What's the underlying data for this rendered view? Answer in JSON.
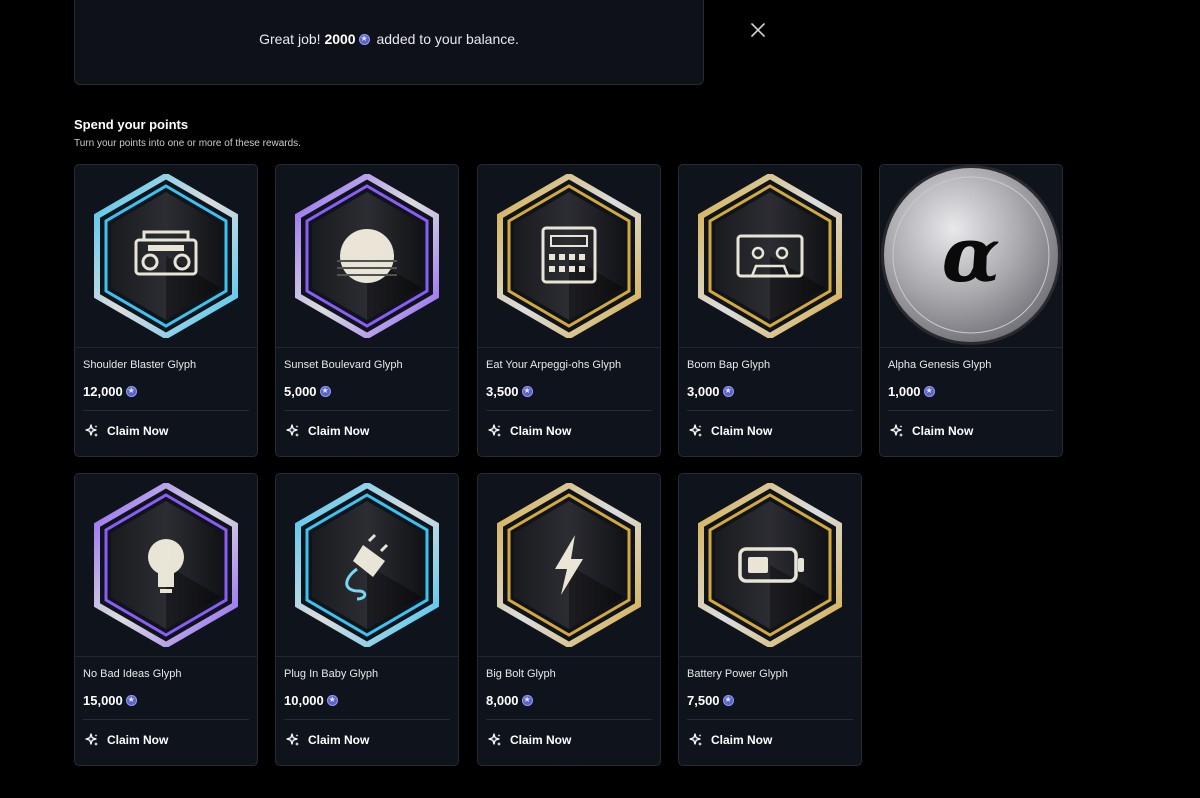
{
  "toast": {
    "prefix": "Great job!",
    "amount": "2000",
    "suffix": "added to your balance.",
    "close_icon": "close-icon"
  },
  "section": {
    "title": "Spend your points",
    "subtitle": "Turn your points into one or more of these rewards."
  },
  "claim_label": "Claim Now",
  "rewards": [
    {
      "name": "Shoulder Blaster Glyph",
      "price": "12,000",
      "icon": "boombox-icon",
      "color": "#3bc3f0"
    },
    {
      "name": "Sunset Boulevard Glyph",
      "price": "5,000",
      "icon": "sunset-icon",
      "color": "#8b5cf6"
    },
    {
      "name": "Eat Your Arpeggi-ohs Glyph",
      "price": "3,500",
      "icon": "drum-machine-icon",
      "color": "#d4a93a"
    },
    {
      "name": "Boom Bap Glyph",
      "price": "3,000",
      "icon": "cassette-icon",
      "color": "#d4a93a"
    },
    {
      "name": "Alpha Genesis Glyph",
      "price": "1,000",
      "icon": "alpha-icon",
      "color": "#c0c0c4"
    },
    {
      "name": "No Bad Ideas Glyph",
      "price": "15,000",
      "icon": "lightbulb-icon",
      "color": "#8b5cf6"
    },
    {
      "name": "Plug In Baby Glyph",
      "price": "10,000",
      "icon": "plug-icon",
      "color": "#3bc3f0"
    },
    {
      "name": "Big Bolt Glyph",
      "price": "8,000",
      "icon": "lightning-bolt-icon",
      "color": "#d4a93a"
    },
    {
      "name": "Battery Power Glyph",
      "price": "7,500",
      "icon": "battery-icon",
      "color": "#d4a93a"
    }
  ]
}
